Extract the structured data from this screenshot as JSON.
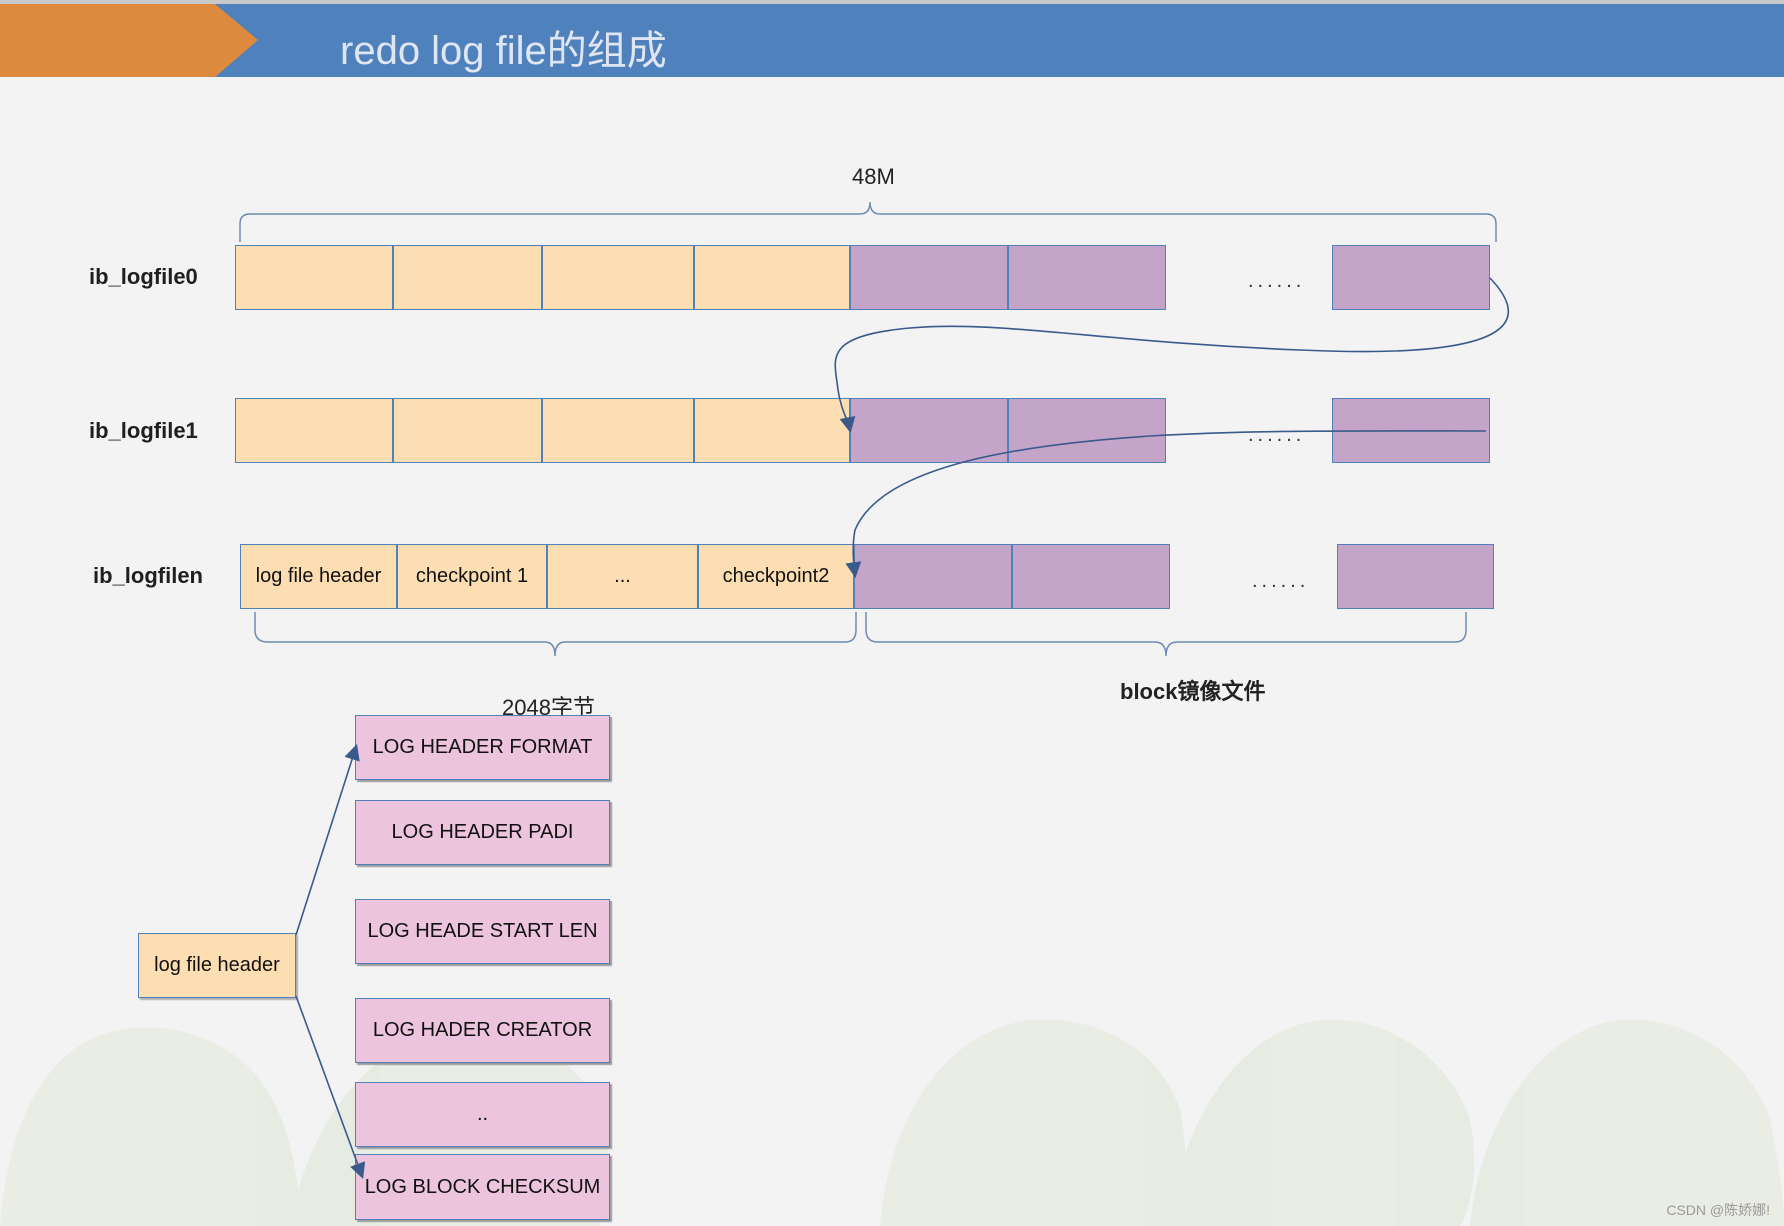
{
  "slide": {
    "title": "redo  log file的组成",
    "watermark": "CSDN @陈娇娜!"
  },
  "colors": {
    "header_blue": "#4f81bd",
    "accent_orange": "#dd8a3e",
    "cell_yellow": "#fddeb2",
    "cell_purple": "#c5a4c9",
    "cell_pink": "#ecc4dd"
  },
  "diagram": {
    "size_label": "48M",
    "rows": [
      {
        "name": "ib_logfile0",
        "ellipsis": "......"
      },
      {
        "name": "ib_logfile1",
        "ellipsis": "......"
      },
      {
        "name": "ib_logfilen",
        "ellipsis": "......",
        "cells": [
          "log file header",
          "checkpoint 1",
          "...",
          "checkpoint2"
        ]
      }
    ],
    "header_size_label": "2048字节",
    "block_mirror_label": "block镜像文件",
    "header_box": "log file header",
    "header_fields": [
      "LOG HEADER FORMAT",
      "LOG HEADER PADI",
      "LOG HEADE START LEN",
      "LOG HADER CREATOR",
      "..",
      "LOG BLOCK CHECKSUM"
    ]
  }
}
